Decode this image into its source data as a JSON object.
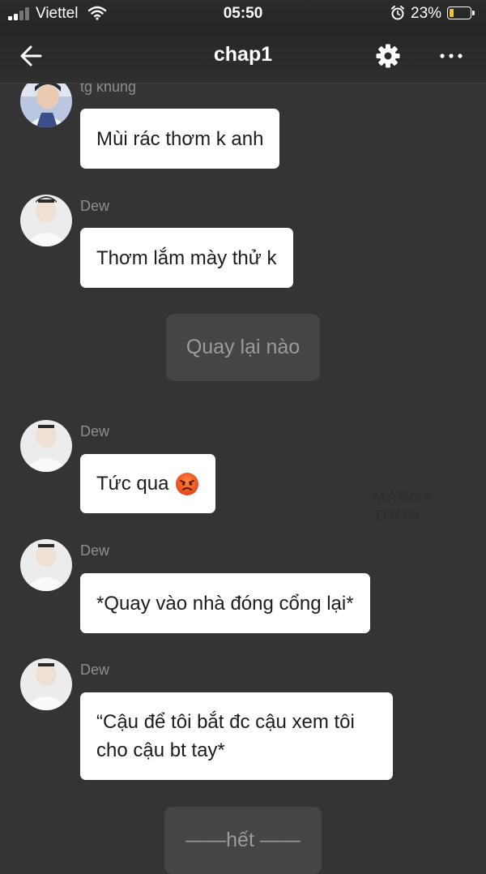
{
  "status_bar": {
    "carrier": "Viettel",
    "time": "05:50",
    "battery_percent": "23%",
    "battery_level": 0.23,
    "battery_color": "#f3c623"
  },
  "header": {
    "title": "chap1",
    "back_icon": "arrow-left-icon",
    "settings_icon": "gear-icon",
    "more_icon": "more-horizontal-icon"
  },
  "messages": [
    {
      "type": "chat",
      "sender": "tg khung",
      "text": "Mùi rác thơm k anh"
    },
    {
      "type": "chat",
      "sender": "Dew",
      "text": "Thơm lắm mày thử k"
    },
    {
      "type": "narration",
      "text": "Quay lại nào"
    },
    {
      "type": "chat",
      "sender": "Dew",
      "text": "Tức qua",
      "emoji": "angry-face-icon"
    },
    {
      "type": "chat",
      "sender": "Dew",
      "text": "*Quay vào nhà đóng cổng lại*"
    },
    {
      "type": "chat",
      "sender": "Dew",
      "text": "“Cậu để tôi bắt đc cậu xem tôi cho cậu bt tay*"
    },
    {
      "type": "narration",
      "text": "——hết ——"
    }
  ],
  "watermark": "MANGA TOON"
}
